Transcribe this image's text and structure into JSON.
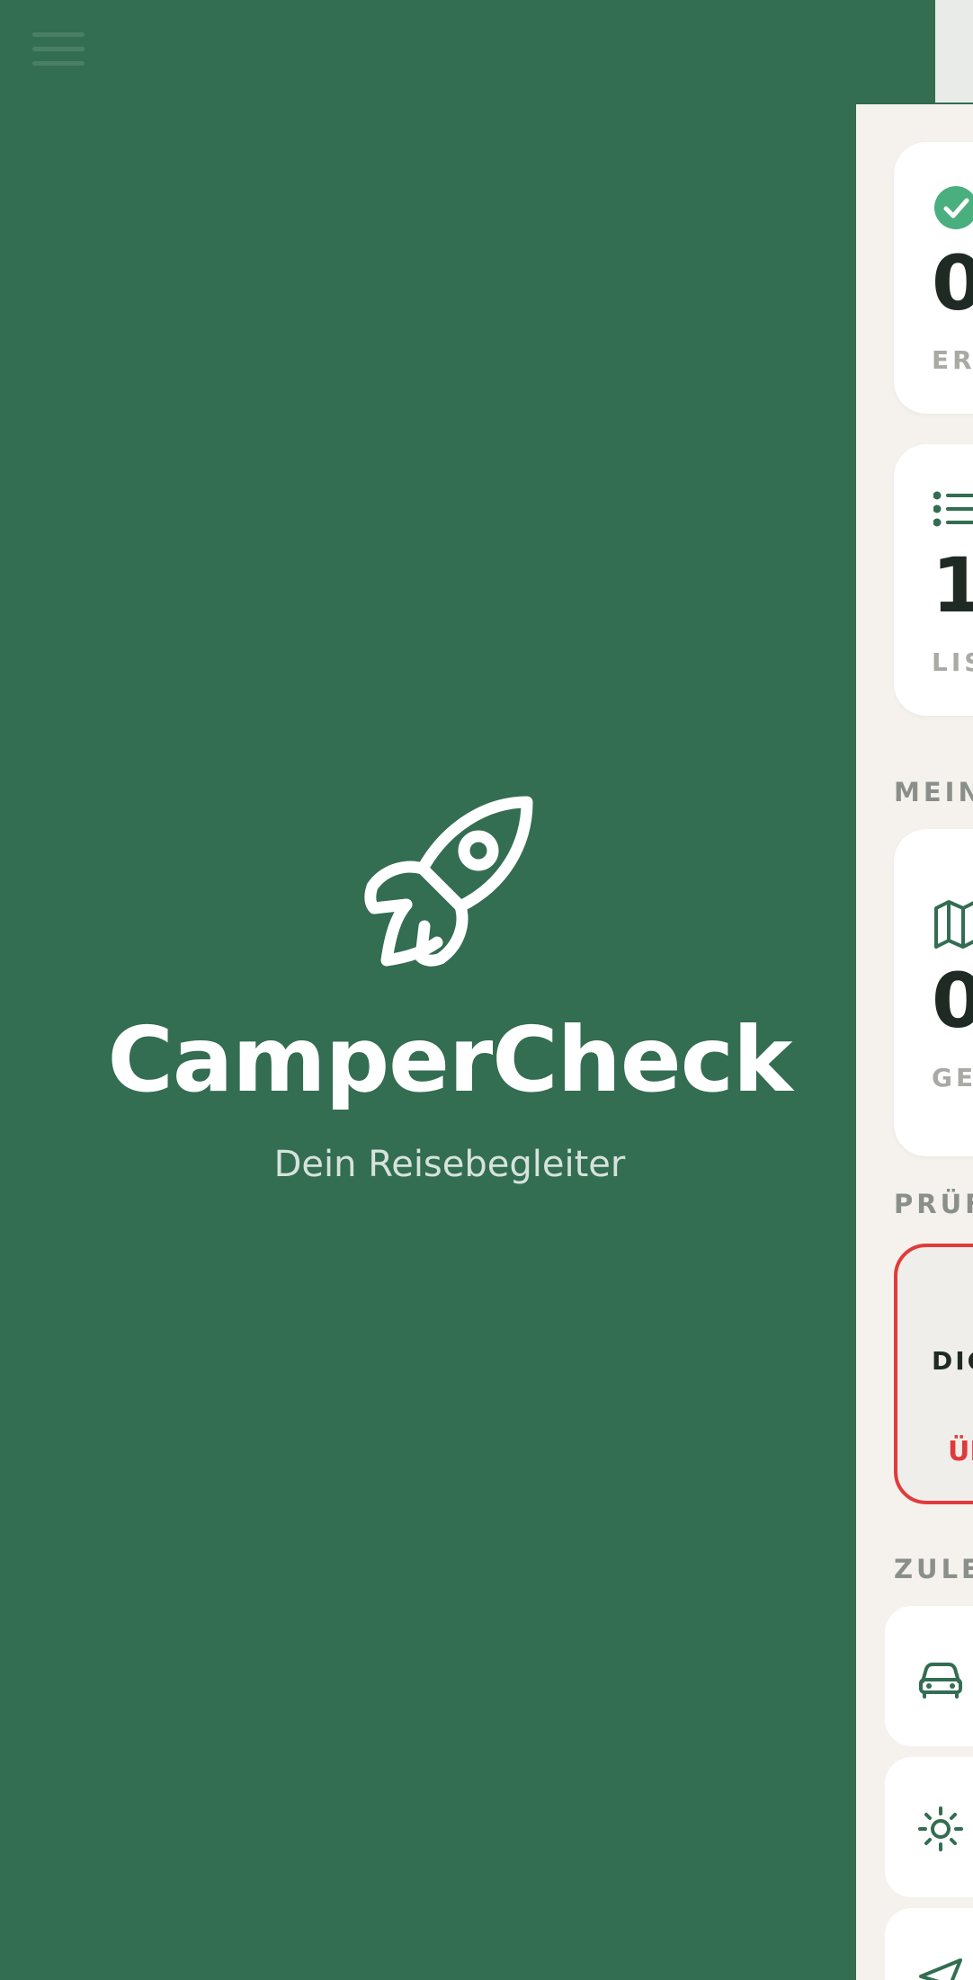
{
  "app": {
    "title": "CamperCheck",
    "subtitle": "Dein Reisebegleiter",
    "icon": "rocket-icon"
  },
  "topbar": {
    "menu_icon": "menu-icon"
  },
  "dashboard": {
    "stats": [
      {
        "icon": "check-circle-icon",
        "value": "0",
        "label": "ERL"
      },
      {
        "icon": "list-icon",
        "value": "1",
        "label": "LIS"
      }
    ],
    "sections": {
      "trips": "MEINE",
      "checks": "PRÜFU",
      "recent": "ZULET"
    },
    "trip_stat": {
      "icon": "map-icon",
      "value": "0",
      "label": "GE"
    },
    "alert": {
      "title": "DIG",
      "link": "ÜB"
    },
    "recent_items": [
      {
        "icon": "car-icon"
      },
      {
        "icon": "sun-icon"
      },
      {
        "icon": "send-icon"
      }
    ]
  },
  "colors": {
    "brand_green": "#336d52",
    "accent_green": "#4aaf7e",
    "alert_red": "#e03b3b",
    "panel_bg": "#f5f2ed"
  }
}
